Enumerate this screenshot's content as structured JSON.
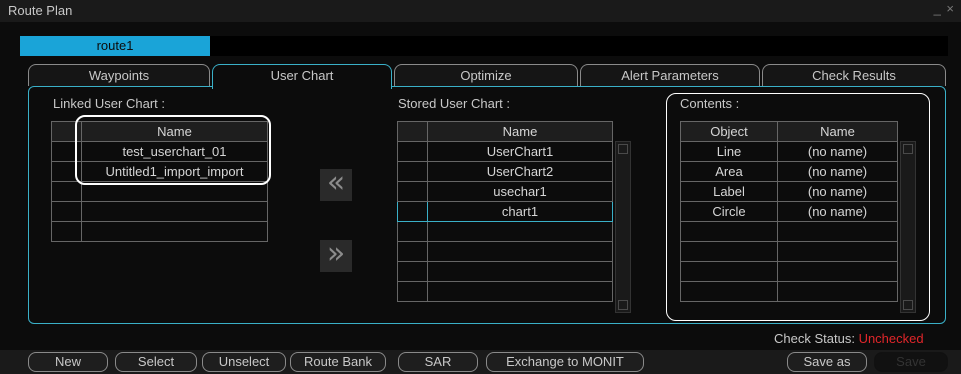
{
  "window": {
    "title": "Route Plan",
    "controls": "_ ×"
  },
  "route": {
    "name": "route1"
  },
  "tabs": [
    "Waypoints",
    "User Chart",
    "Optimize",
    "Alert Parameters",
    "Check Results"
  ],
  "linked": {
    "label": "Linked User Chart :",
    "header": "Name",
    "rows": [
      "test_userchart_01",
      "Untitled1_import_import",
      "",
      "",
      ""
    ]
  },
  "move_buttons": {
    "left": "«",
    "right": "»"
  },
  "stored": {
    "label": "Stored User Chart :",
    "header": "Name",
    "rows": [
      "UserChart1",
      "UserChart2",
      "usechar1",
      "chart1",
      "",
      "",
      "",
      ""
    ]
  },
  "contents": {
    "label": "Contents :",
    "headers": [
      "Object",
      "Name"
    ],
    "rows": [
      [
        "Line",
        "(no name)"
      ],
      [
        "Area",
        "(no name)"
      ],
      [
        "Label",
        "(no name)"
      ],
      [
        "Circle",
        "(no name)"
      ],
      [
        "",
        ""
      ],
      [
        "",
        ""
      ],
      [
        "",
        ""
      ],
      [
        "",
        ""
      ]
    ]
  },
  "status": {
    "label": "Check Status:",
    "value": "Unchecked",
    "value_color": "#e0262a"
  },
  "buttons": [
    "New",
    "Select",
    "Unselect",
    "Route Bank",
    "SAR",
    "Exchange to MONIT",
    "Save as",
    "Save"
  ]
}
